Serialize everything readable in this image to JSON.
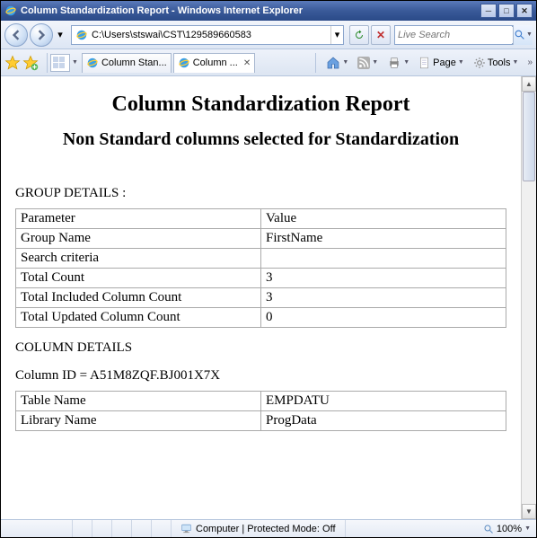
{
  "window": {
    "title": "Column Standardization Report - Windows Internet Explorer"
  },
  "address": {
    "path": "C:\\Users\\stswai\\CST\\129589660583"
  },
  "search": {
    "placeholder": "Live Search"
  },
  "tabs": {
    "inactive_label": "Column Stan...",
    "active_label": "Column ..."
  },
  "toolbar": {
    "page": "Page",
    "tools": "Tools"
  },
  "report": {
    "h1": "Column Standardization Report",
    "h2": "Non Standard columns selected for Standardization",
    "group_label": "GROUP DETAILS :",
    "column_label": "COLUMN DETAILS",
    "column_id_line": "Column ID = A51M8ZQF.BJ001X7X",
    "group_table": {
      "r0c0": "Parameter",
      "r0c1": "Value",
      "r1c0": "Group Name",
      "r1c1": "FirstName",
      "r2c0": "Search criteria",
      "r2c1": "",
      "r3c0": "Total Count",
      "r3c1": "3",
      "r4c0": "Total Included Column Count",
      "r4c1": "3",
      "r5c0": "Total Updated Column Count",
      "r5c1": "0"
    },
    "col_table": {
      "r0c0": "Table Name",
      "r0c1": "EMPDATU",
      "r1c0": "Library Name",
      "r1c1": "ProgData"
    }
  },
  "status": {
    "protected": "Computer | Protected Mode: Off",
    "zoom": "100%"
  }
}
